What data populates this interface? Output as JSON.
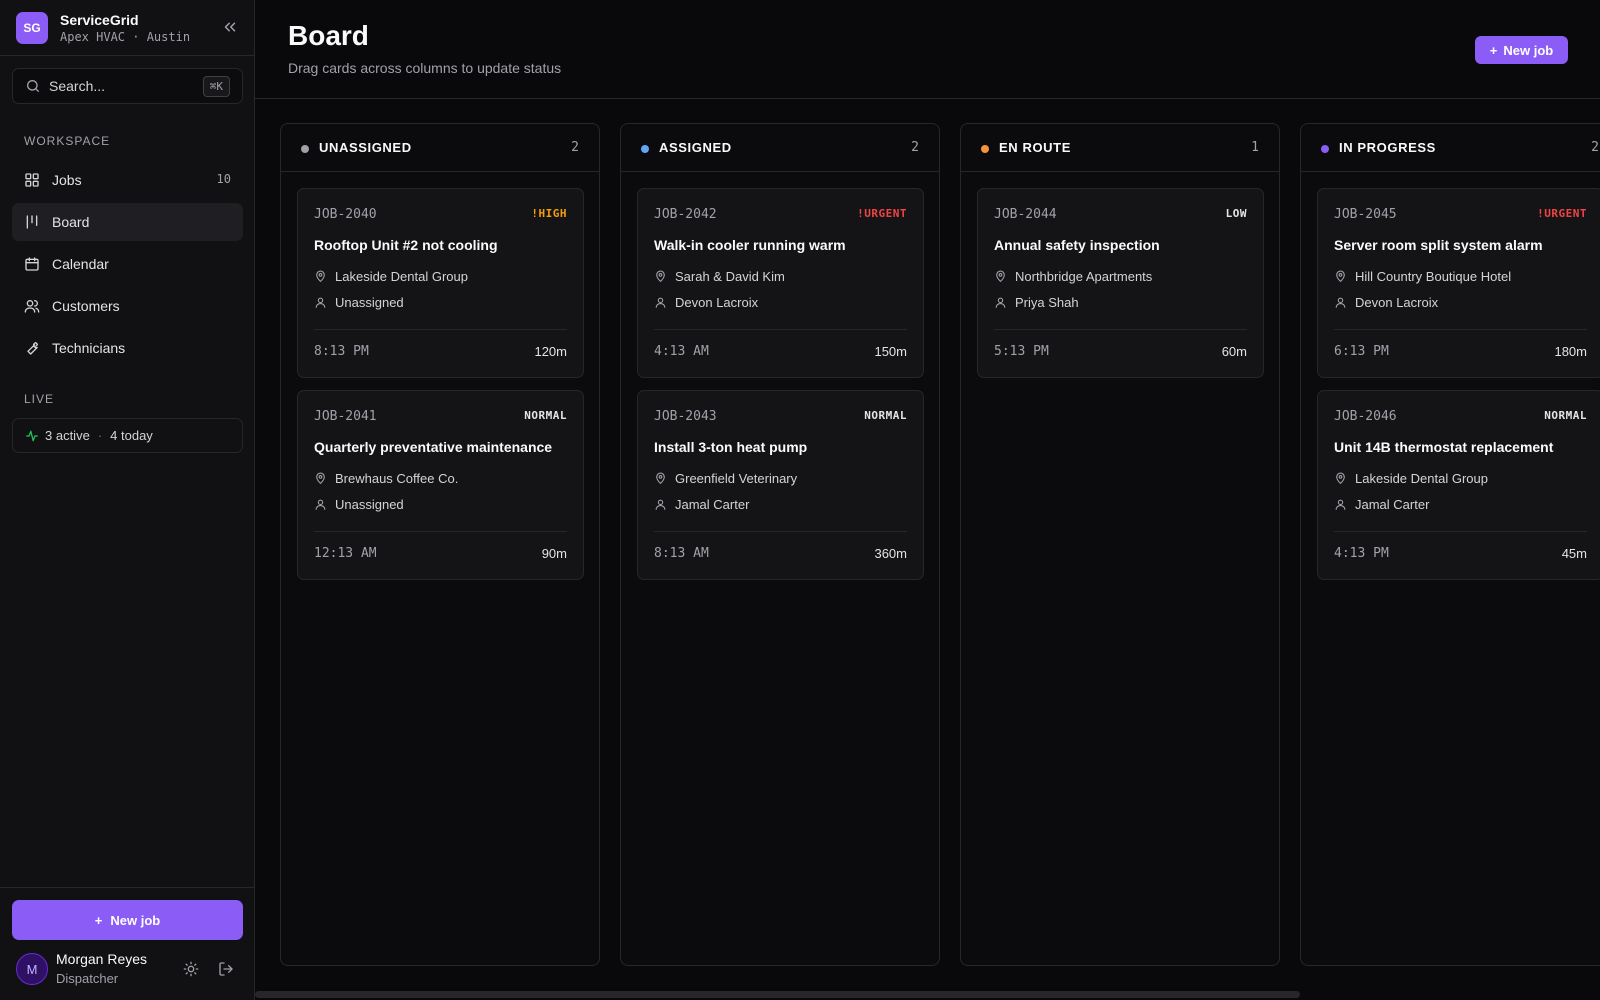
{
  "app": {
    "logo": "SG",
    "name": "ServiceGrid",
    "org": "Apex HVAC · Austin"
  },
  "search": {
    "placeholder": "Search...",
    "shortcut": "⌘K"
  },
  "sidebar": {
    "workspace_label": "WORKSPACE",
    "items": [
      {
        "label": "Jobs",
        "icon": "grid-icon",
        "count": "10"
      },
      {
        "label": "Board",
        "icon": "kanban-icon",
        "count": ""
      },
      {
        "label": "Calendar",
        "icon": "calendar-icon",
        "count": ""
      },
      {
        "label": "Customers",
        "icon": "users-icon",
        "count": ""
      },
      {
        "label": "Technicians",
        "icon": "wrench-icon",
        "count": ""
      }
    ],
    "active_item": "Board",
    "live_label": "LIVE",
    "live": {
      "active": "3 active",
      "sep": "·",
      "today": "4 today"
    },
    "new_job_label": "New job",
    "user": {
      "initial": "M",
      "name": "Morgan Reyes",
      "role": "Dispatcher"
    }
  },
  "header": {
    "title": "Board",
    "subtitle": "Drag cards across columns to update status",
    "new_job_label": "New job"
  },
  "colors": {
    "accent": "#8b5cf6",
    "high": "#f59e0b",
    "urgent": "#ef4444",
    "normal": "#e4e4e7",
    "low": "#e4e4e7"
  },
  "columns": [
    {
      "title": "UNASSIGNED",
      "count": "2",
      "dot": "#a1a1aa",
      "cards": [
        {
          "id": "JOB-2040",
          "priority": "!HIGH",
          "priority_color": "#f59e0b",
          "title": "Rooftop Unit #2 not cooling",
          "customer": "Lakeside Dental Group",
          "tech": "Unassigned",
          "time": "8:13 PM",
          "duration": "120m"
        },
        {
          "id": "JOB-2041",
          "priority": "NORMAL",
          "priority_color": "#e4e4e7",
          "title": "Quarterly preventative maintenance",
          "customer": "Brewhaus Coffee Co.",
          "tech": "Unassigned",
          "time": "12:13 AM",
          "duration": "90m"
        }
      ]
    },
    {
      "title": "ASSIGNED",
      "count": "2",
      "dot": "#60a5fa",
      "cards": [
        {
          "id": "JOB-2042",
          "priority": "!URGENT",
          "priority_color": "#ef4444",
          "title": "Walk-in cooler running warm",
          "customer": "Sarah & David Kim",
          "tech": "Devon Lacroix",
          "time": "4:13 AM",
          "duration": "150m"
        },
        {
          "id": "JOB-2043",
          "priority": "NORMAL",
          "priority_color": "#e4e4e7",
          "title": "Install 3-ton heat pump",
          "customer": "Greenfield Veterinary",
          "tech": "Jamal Carter",
          "time": "8:13 AM",
          "duration": "360m"
        }
      ]
    },
    {
      "title": "EN ROUTE",
      "count": "1",
      "dot": "#fb923c",
      "cards": [
        {
          "id": "JOB-2044",
          "priority": "LOW",
          "priority_color": "#e4e4e7",
          "title": "Annual safety inspection",
          "customer": "Northbridge Apartments",
          "tech": "Priya Shah",
          "time": "5:13 PM",
          "duration": "60m"
        }
      ]
    },
    {
      "title": "IN PROGRESS",
      "count": "2",
      "dot": "#8b5cf6",
      "cards": [
        {
          "id": "JOB-2045",
          "priority": "!URGENT",
          "priority_color": "#ef4444",
          "title": "Server room split system alarm",
          "customer": "Hill Country Boutique Hotel",
          "tech": "Devon Lacroix",
          "time": "6:13 PM",
          "duration": "180m"
        },
        {
          "id": "JOB-2046",
          "priority": "NORMAL",
          "priority_color": "#e4e4e7",
          "title": "Unit 14B thermostat replacement",
          "customer": "Lakeside Dental Group",
          "tech": "Jamal Carter",
          "time": "4:13 PM",
          "duration": "45m"
        }
      ]
    }
  ]
}
